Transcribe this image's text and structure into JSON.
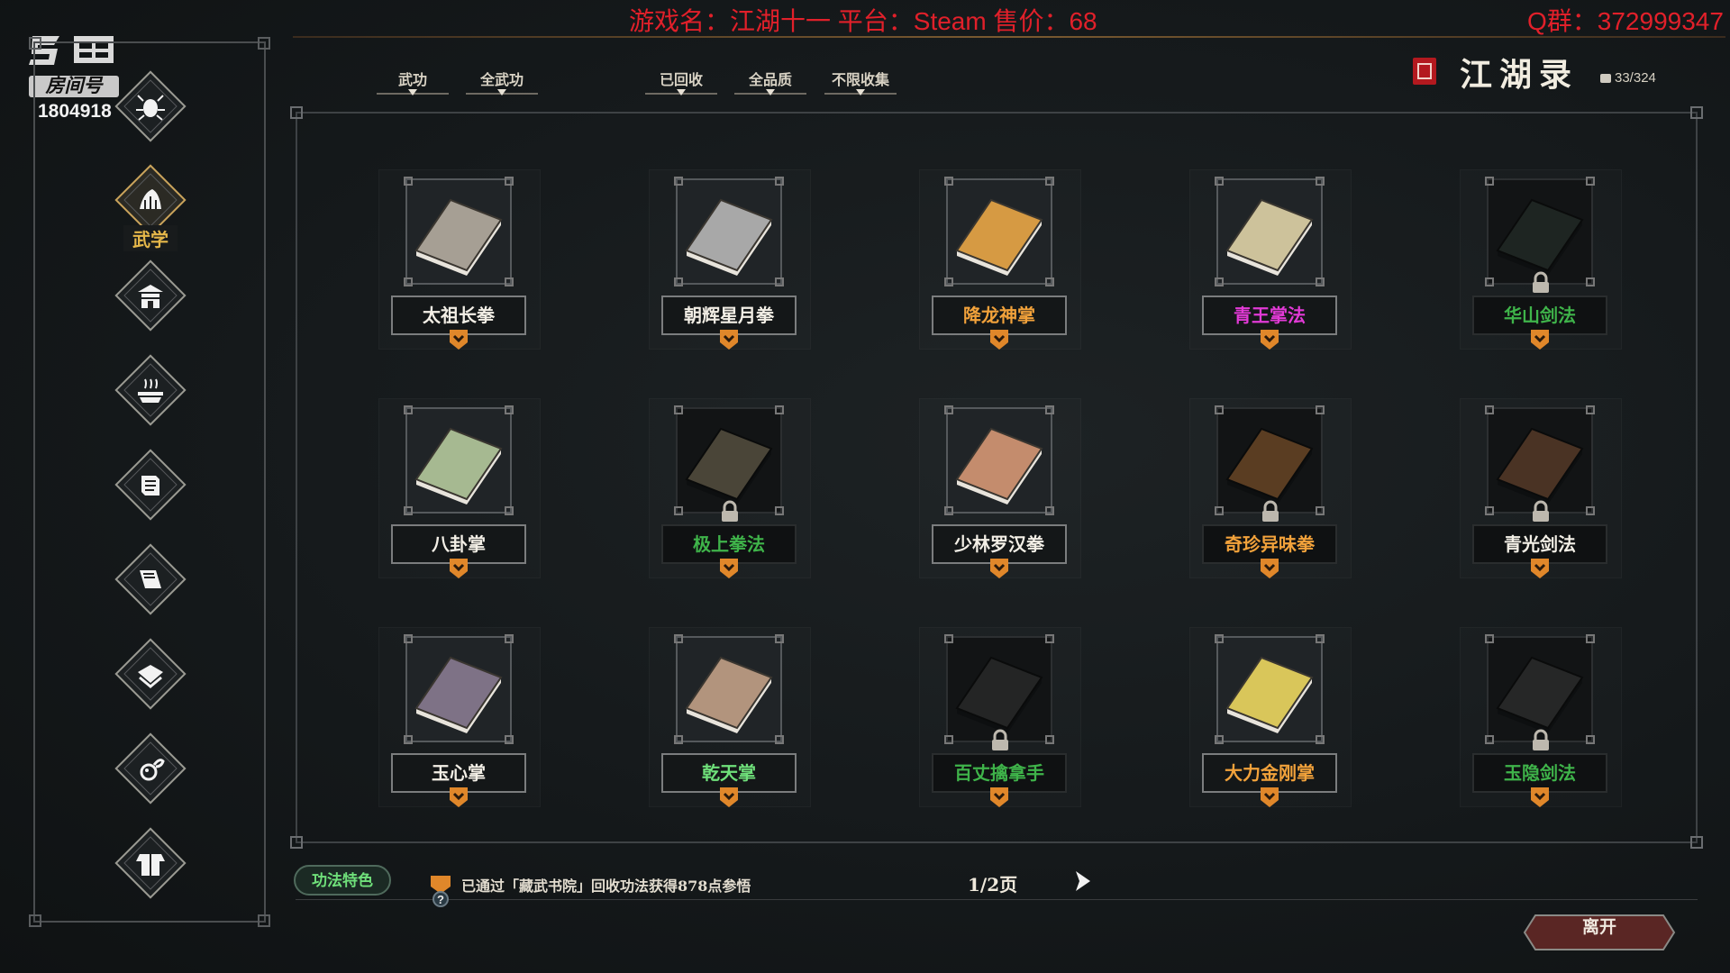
{
  "overlay": {
    "game_info": "游戏名：江湖十一 平台：Steam 售价：68",
    "qq_group": "Q群：372999347",
    "room_label": "房间号",
    "room_number": "1804918"
  },
  "sidebar": {
    "items": [
      {
        "icon": "bug-icon",
        "label": ""
      },
      {
        "icon": "martial-arts-icon",
        "label": "武学",
        "active": true
      },
      {
        "icon": "house-icon",
        "label": ""
      },
      {
        "icon": "pot-icon",
        "label": ""
      },
      {
        "icon": "scroll-icon",
        "label": ""
      },
      {
        "icon": "book-icon",
        "label": ""
      },
      {
        "icon": "armor-icon",
        "label": ""
      },
      {
        "icon": "beast-icon",
        "label": ""
      },
      {
        "icon": "robe-icon",
        "label": ""
      }
    ]
  },
  "filters": {
    "tabs": [
      "武功",
      "全武功",
      "已回收",
      "全品质",
      "不限收集"
    ]
  },
  "title": {
    "text": "江湖录",
    "progress": "33/324"
  },
  "cards": [
    {
      "name": "太祖长拳",
      "color": "#f3efe6",
      "locked": false,
      "book": "#a69f94"
    },
    {
      "name": "朝辉星月拳",
      "color": "#f3efe6",
      "locked": false,
      "book": "#a8a8a8"
    },
    {
      "name": "降龙神掌",
      "color": "#f2a23b",
      "locked": false,
      "book": "#d69a43"
    },
    {
      "name": "青王掌法",
      "color": "#e23ad6",
      "locked": false,
      "book": "#cdc29b"
    },
    {
      "name": "华山剑法",
      "color": "#3fb44a",
      "locked": true,
      "book": "#1e2522"
    },
    {
      "name": "八卦掌",
      "color": "#f3efe6",
      "locked": false,
      "book": "#a6b991"
    },
    {
      "name": "极上拳法",
      "color": "#3fb44a",
      "locked": true,
      "book": "#4a4538"
    },
    {
      "name": "少林罗汉拳",
      "color": "#f3efe6",
      "locked": false,
      "book": "#c48c6d"
    },
    {
      "name": "奇珍异味拳",
      "color": "#f2a23b",
      "locked": true,
      "book": "#5a3d22"
    },
    {
      "name": "青光剑法",
      "color": "#f3efe6",
      "locked": true,
      "book": "#4a3324"
    },
    {
      "name": "玉心掌",
      "color": "#f3efe6",
      "locked": false,
      "book": "#7e7286"
    },
    {
      "name": "乾天掌",
      "color": "#6fe07a",
      "locked": false,
      "book": "#b2947d"
    },
    {
      "name": "百丈擒拿手",
      "color": "#3fb44a",
      "locked": true,
      "book": "#242525"
    },
    {
      "name": "大力金刚掌",
      "color": "#f2a23b",
      "locked": false,
      "book": "#d9c65a"
    },
    {
      "name": "玉隐剑法",
      "color": "#3fb44a",
      "locked": true,
      "book": "#262727"
    }
  ],
  "bottom": {
    "feature_button": "功法特色",
    "info_text": "已通过「藏武书院」回收功法获得878点参悟",
    "page": "1/2页",
    "leave_button": "离开"
  },
  "colors": {
    "accent_gold": "#c9a35b",
    "badge_orange": "#e0872a",
    "overlay_red": "#e1202a"
  }
}
